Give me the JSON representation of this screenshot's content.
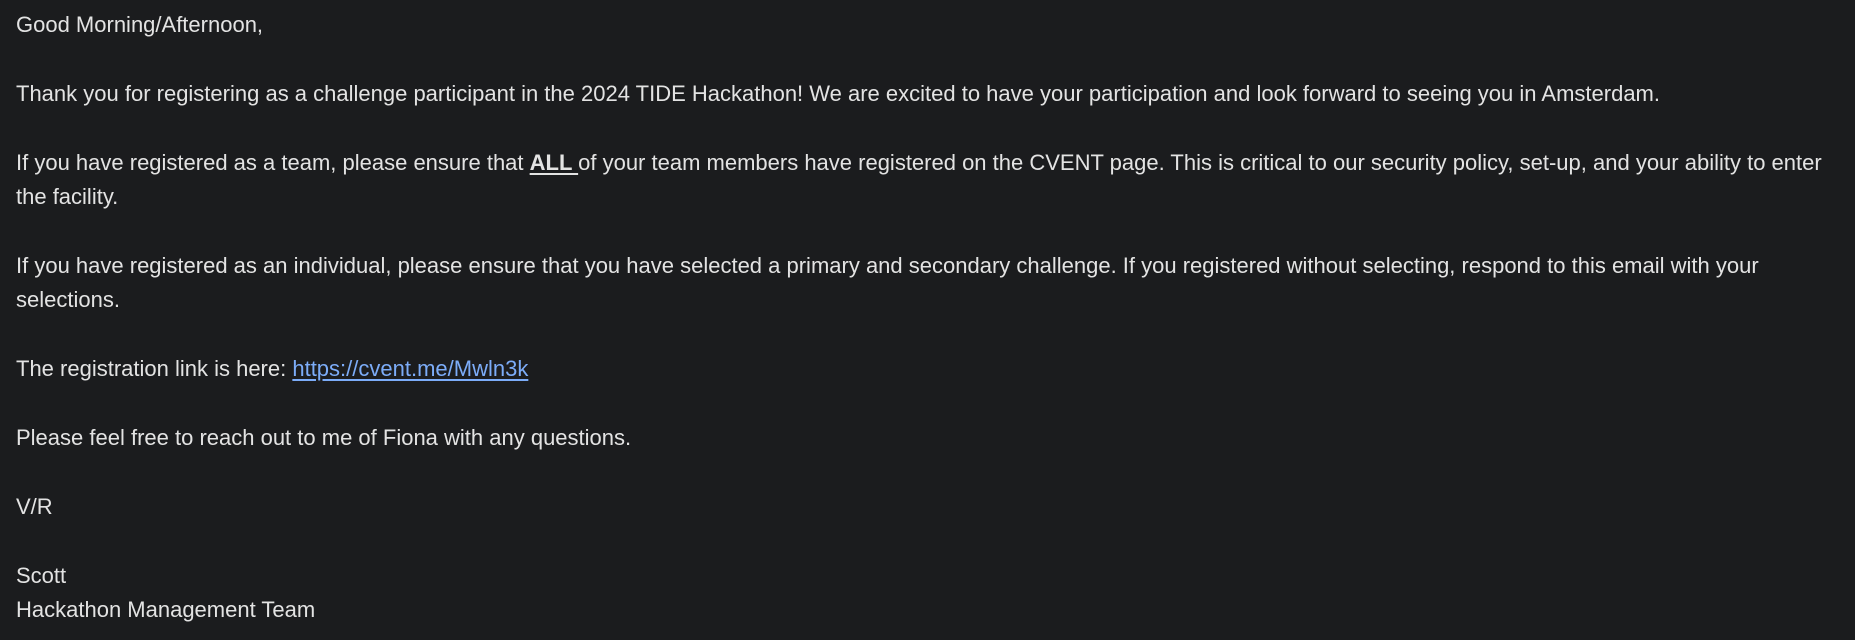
{
  "email": {
    "greeting": "Good Morning/Afternoon,",
    "paragraph_thanks": "Thank you for registering as a challenge participant in the 2024 TIDE Hackathon! We are excited to have your participation and look forward to seeing you in Amsterdam.",
    "team_para": {
      "before": "If you have registered as a team, please ensure that ",
      "emphasis": "ALL ",
      "after": "of your team members have registered on the CVENT page. This is critical to our security policy, set-up, and your ability to enter the facility."
    },
    "paragraph_individual": "If you have registered as an individual, please ensure that you have selected a primary and secondary challenge. If you registered without selecting, respond to this email with your selections.",
    "registration": {
      "label": "The registration link is here: ",
      "link_text": "https://cvent.me/Mwln3k"
    },
    "paragraph_questions": "Please feel free to reach out to me of Fiona with any questions.",
    "closing": "V/R",
    "signature": {
      "name": "Scott",
      "team": "Hackathon Management Team"
    }
  }
}
